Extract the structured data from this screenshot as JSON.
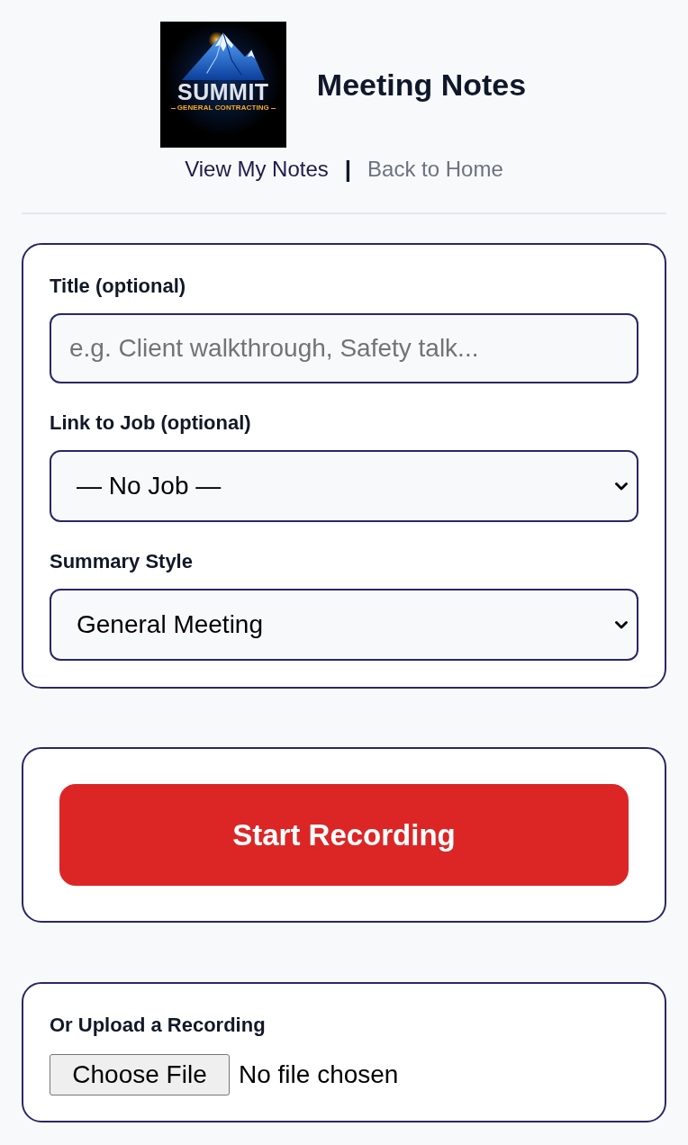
{
  "header": {
    "logo": {
      "wordmark": "SUMMIT",
      "tagline": "GENERAL CONTRACTING"
    },
    "title": "Meeting Notes"
  },
  "nav": {
    "links": [
      {
        "label": "View My Notes",
        "kind": "primary"
      },
      {
        "label": "Back to Home",
        "kind": "muted"
      }
    ],
    "separator": "|"
  },
  "details_card": {
    "fields": [
      {
        "kind": "text",
        "label": "Title (optional)",
        "placeholder": "e.g. Client walkthrough, Safety talk..."
      },
      {
        "kind": "select",
        "label": "Link to Job (optional)",
        "value": "— No Job —"
      },
      {
        "kind": "select",
        "label": "Summary Style",
        "value": "General Meeting"
      }
    ]
  },
  "record_card": {
    "button": "Start Recording"
  },
  "upload_card": {
    "label": "Or Upload a Recording",
    "button": "Choose File",
    "status": "No file chosen"
  }
}
